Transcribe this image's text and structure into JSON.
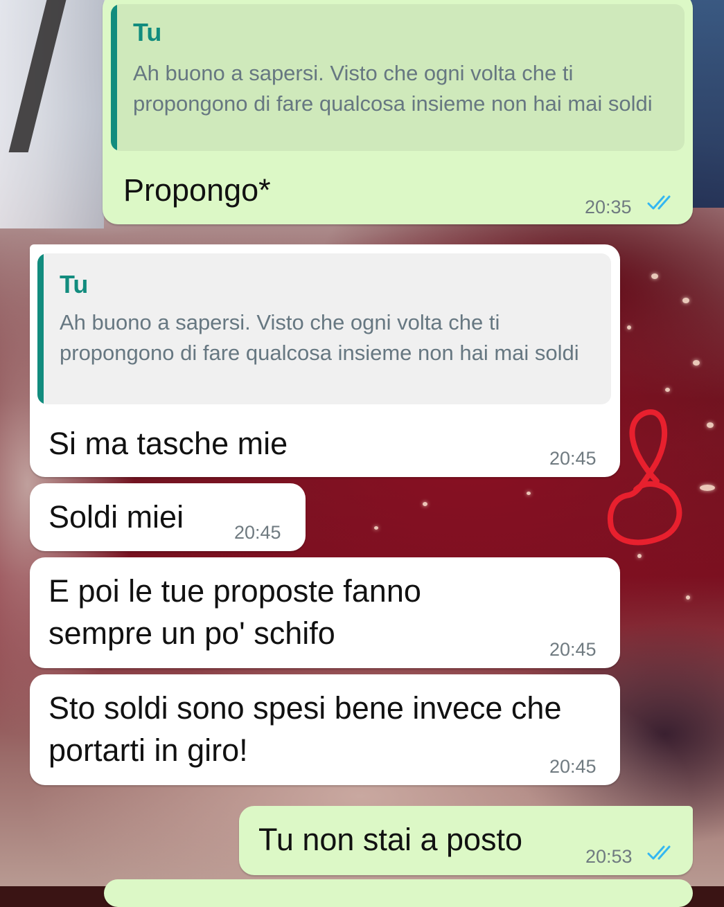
{
  "messages": [
    {
      "direction": "outgoing",
      "quoted": {
        "author": "Tu",
        "text": "Ah buono a sapersi. Visto che ogni volta che ti propongono di fare qualcosa insieme non hai mai soldi"
      },
      "text": "Propongo*",
      "time": "20:35",
      "status": "read"
    },
    {
      "direction": "incoming",
      "quoted": {
        "author": "Tu",
        "text": "Ah buono a sapersi. Visto che ogni volta che ti propongono di fare qualcosa insieme non hai mai soldi"
      },
      "text": "Si ma tasche mie",
      "time": "20:45"
    },
    {
      "direction": "incoming",
      "text": "Soldi miei",
      "time": "20:45"
    },
    {
      "direction": "incoming",
      "text": "E poi le tue proposte fanno sempre un po' schifo",
      "time": "20:45"
    },
    {
      "direction": "incoming",
      "text": "Sto soldi sono spesi bene invece che portarti in giro!",
      "time": "20:45"
    },
    {
      "direction": "outgoing",
      "text": "Tu non stai a posto",
      "time": "20:53",
      "status": "read"
    }
  ],
  "colors": {
    "outgoing_bubble": "#dcf8c6",
    "incoming_bubble": "#ffffff",
    "quote_accent": "#128c7e",
    "read_ticks": "#34b7f1",
    "annotation": "#e8202e"
  },
  "icons": {
    "read_receipt": "double-check-icon",
    "annotation": "red-hand-drawn-scribble"
  }
}
